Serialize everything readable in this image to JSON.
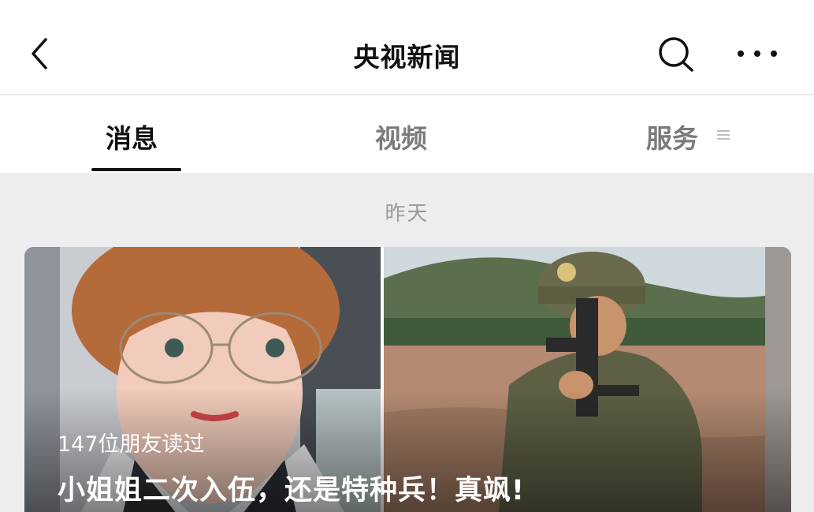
{
  "header": {
    "title": "央视新闻"
  },
  "tabs": [
    {
      "label": "消息",
      "active": true
    },
    {
      "label": "视频",
      "active": false
    },
    {
      "label": "服务",
      "active": false
    }
  ],
  "feed": {
    "date_label": "昨天",
    "card": {
      "read_count_text": "147位朋友读过",
      "headline": "小姐姐二次入伍，还是特种兵！真飒!"
    }
  },
  "icons": {
    "back": "chevron-left-icon",
    "search": "search-icon",
    "more": "more-dots-icon",
    "tab_menu": "menu-lines-icon"
  },
  "colors": {
    "active_tab": "#111111",
    "inactive_tab": "#7b7b7b",
    "date_text": "#9b9b9b",
    "background": "#ededed"
  }
}
